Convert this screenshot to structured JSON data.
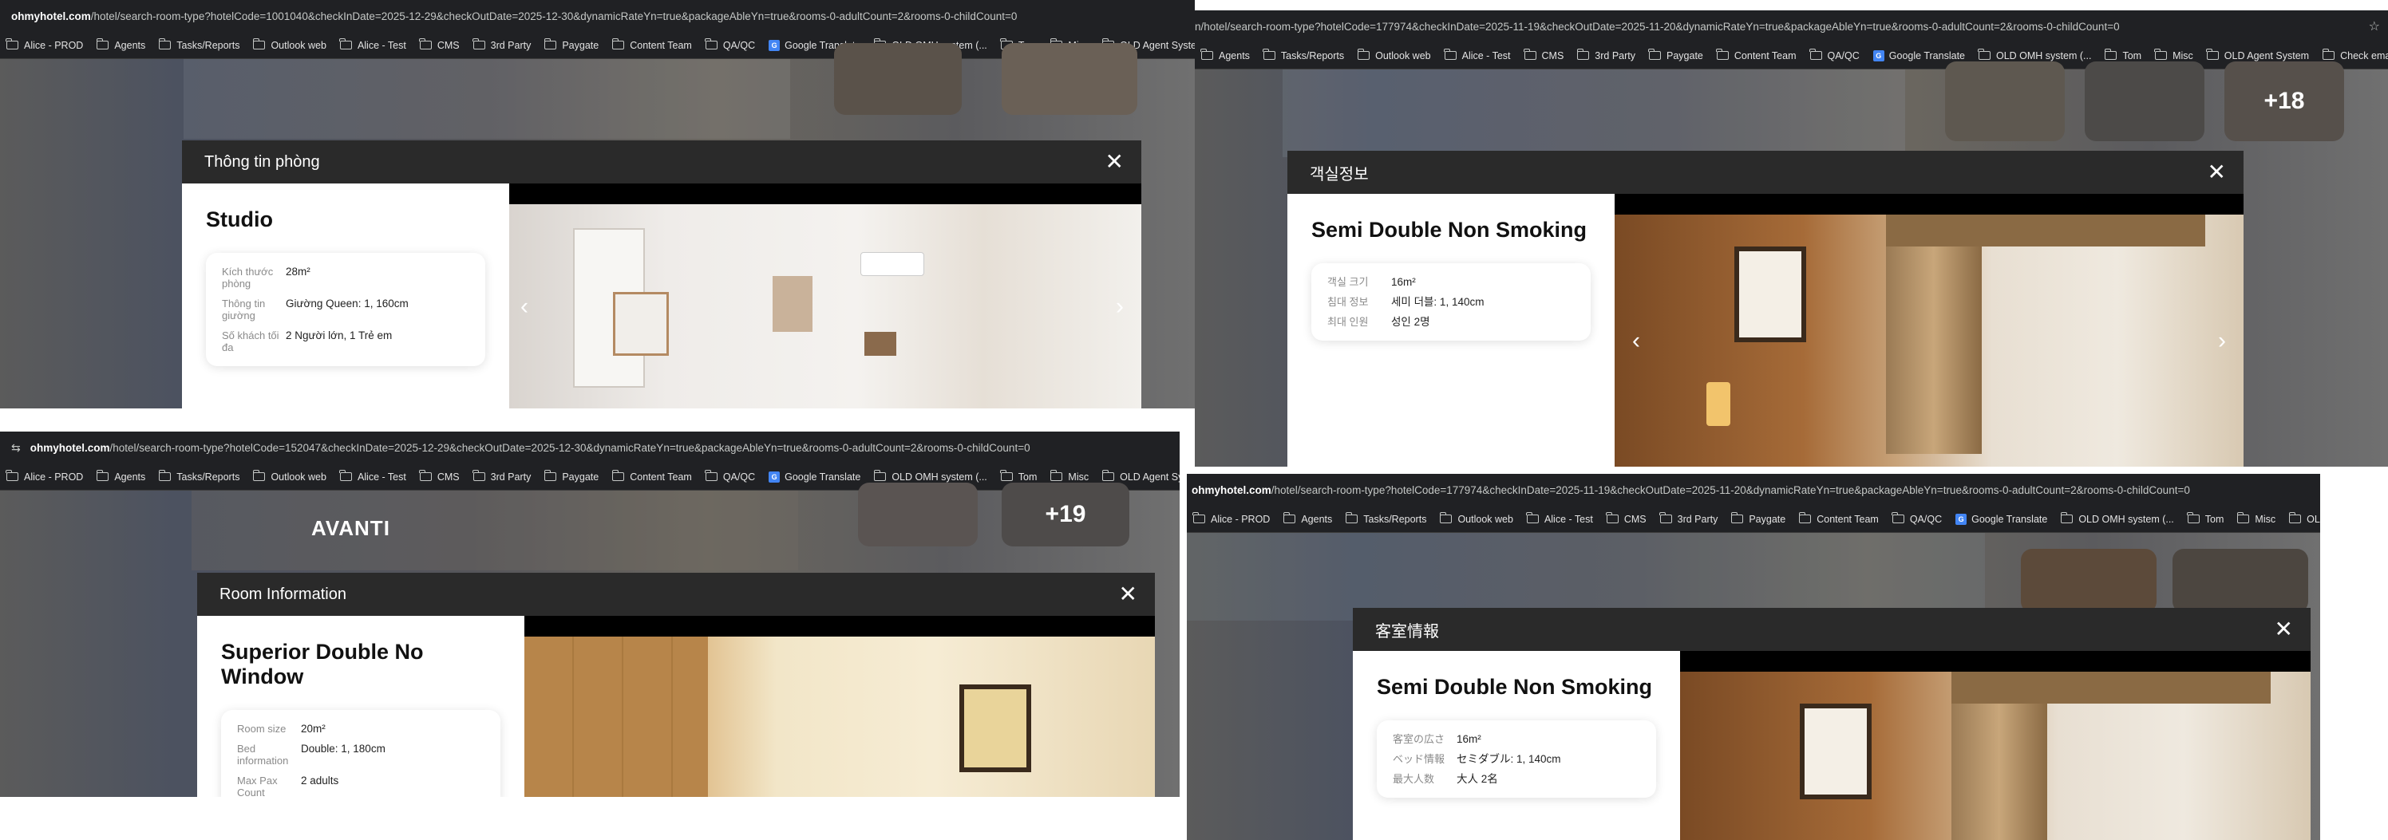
{
  "bookmarks": [
    {
      "label": "Alice - PROD"
    },
    {
      "label": "Agents"
    },
    {
      "label": "Tasks/Reports"
    },
    {
      "label": "Outlook web"
    },
    {
      "label": "Alice - Test"
    },
    {
      "label": "CMS"
    },
    {
      "label": "3rd Party"
    },
    {
      "label": "Paygate"
    },
    {
      "label": "Content Team"
    },
    {
      "label": "QA/QC"
    },
    {
      "label": "Google Translate"
    },
    {
      "label": "OLD OMH system (..."
    },
    {
      "label": "Tom"
    },
    {
      "label": "Misc"
    },
    {
      "label": "OLD Agent System"
    },
    {
      "label": "Check ema"
    }
  ],
  "panels": [
    {
      "domain": "ohmyhotel.com",
      "path": "/hotel/search-room-type?hotelCode=1001040&checkInDate=2025-12-29&checkOutDate=2025-12-30&dynamicRateYn=true&packageAbleYn=true&rooms-0-adultCount=2&rooms-0-childCount=0",
      "header": "Thông tin phòng",
      "room_name": "Studio",
      "rows": [
        {
          "label": "Kích thước phòng",
          "value": "28m²"
        },
        {
          "label": "Thông tin giường",
          "value": "Giường Queen: 1, 160cm"
        },
        {
          "label": "Số khách tối đa",
          "value": "2 Người lớn, 1 Trẻ em"
        }
      ]
    },
    {
      "domain": "",
      "path": "n/hotel/search-room-type?hotelCode=177974&checkInDate=2025-11-19&checkOutDate=2025-11-20&dynamicRateYn=true&packageAbleYn=true&rooms-0-adultCount=2&rooms-0-childCount=0",
      "header": "객실정보",
      "room_name": "Semi Double Non Smoking",
      "rows": [
        {
          "label": "객실 크기",
          "value": "16m²"
        },
        {
          "label": "침대 정보",
          "value": "세미 더블: 1, 140cm"
        },
        {
          "label": "최대 인원",
          "value": "성인 2명"
        }
      ],
      "thumb_count": "+18"
    },
    {
      "domain": "ohmyhotel.com",
      "path": "/hotel/search-room-type?hotelCode=152047&checkInDate=2025-12-29&checkOutDate=2025-12-30&dynamicRateYn=true&packageAbleYn=true&rooms-0-adultCount=2&rooms-0-childCount=0",
      "header": "Room Information",
      "room_name": "Superior Double No Window",
      "rows": [
        {
          "label": "Room size",
          "value": "20m²"
        },
        {
          "label": "Bed information",
          "value": "Double: 1, 180cm"
        },
        {
          "label": "Max Pax Count",
          "value": "2 adults"
        }
      ],
      "thumb_count": "+19",
      "sign_text": "AVANTI"
    },
    {
      "domain": "ohmyhotel.com",
      "path": "/hotel/search-room-type?hotelCode=177974&checkInDate=2025-11-19&checkOutDate=2025-11-20&dynamicRateYn=true&packageAbleYn=true&rooms-0-adultCount=2&rooms-0-childCount=0",
      "header": "客室情報",
      "room_name": "Semi Double Non Smoking",
      "rows": [
        {
          "label": "客室の広さ",
          "value": "16m²"
        },
        {
          "label": "ベッド情報",
          "value": "セミダブル: 1, 140cm"
        },
        {
          "label": "最大人数",
          "value": "大人 2名"
        }
      ]
    }
  ],
  "icons": {
    "close": "close-icon",
    "prev": "chevron-left-icon",
    "next": "chevron-right-icon",
    "folder": "folder-icon",
    "star": "star-icon"
  }
}
